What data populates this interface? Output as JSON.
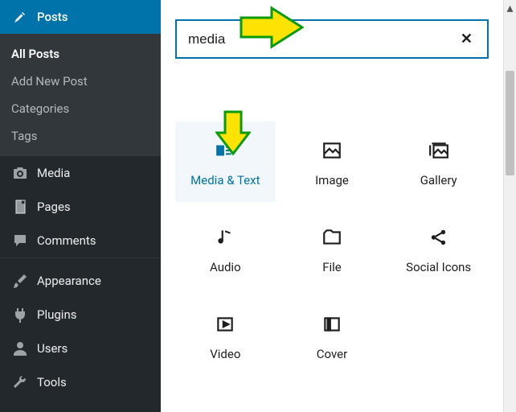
{
  "sidebar": {
    "active": {
      "label": "Posts"
    },
    "sub": {
      "all": "All Posts",
      "add": "Add New Post",
      "cat": "Categories",
      "tags": "Tags"
    },
    "media": "Media",
    "pages": "Pages",
    "comments": "Comments",
    "appearance": "Appearance",
    "plugins": "Plugins",
    "users": "Users",
    "tools": "Tools"
  },
  "search": {
    "value": "media"
  },
  "blocks": {
    "mediaText": "Media & Text",
    "image": "Image",
    "gallery": "Gallery",
    "audio": "Audio",
    "file": "File",
    "social": "Social Icons",
    "video": "Video",
    "cover": "Cover"
  }
}
